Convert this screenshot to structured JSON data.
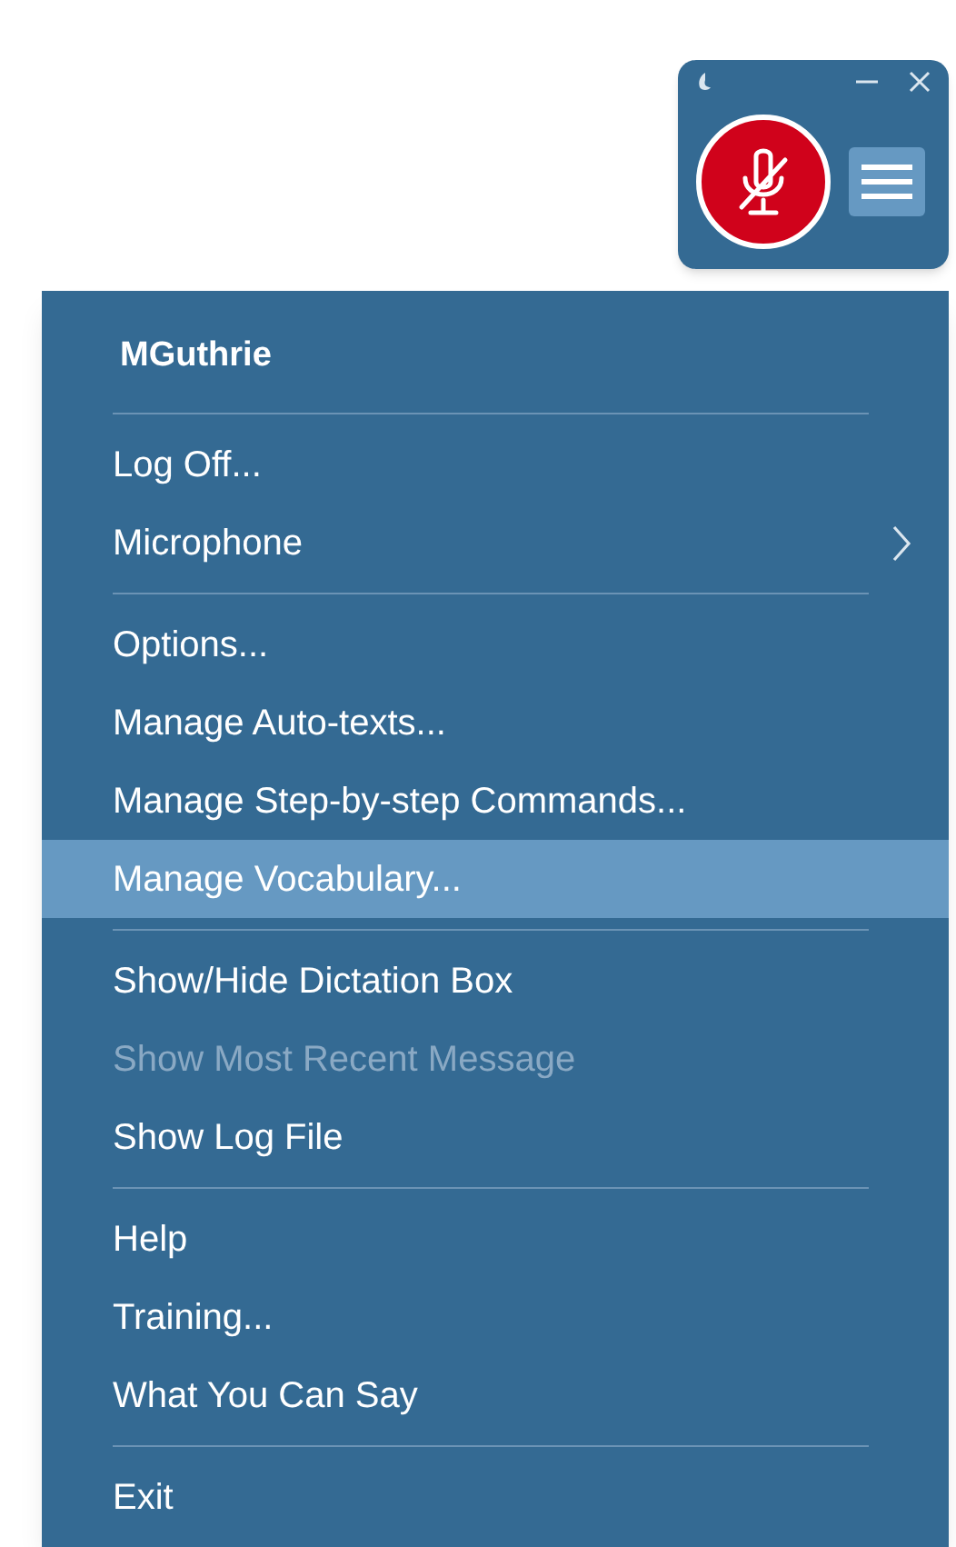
{
  "widget": {
    "menu_open": true
  },
  "menu": {
    "header": "MGuthrie",
    "groups": [
      [
        {
          "label": "Log Off...",
          "selected": false,
          "disabled": false,
          "has_submenu": false
        },
        {
          "label": "Microphone",
          "selected": false,
          "disabled": false,
          "has_submenu": true
        }
      ],
      [
        {
          "label": "Options...",
          "selected": false,
          "disabled": false,
          "has_submenu": false
        },
        {
          "label": "Manage Auto-texts...",
          "selected": false,
          "disabled": false,
          "has_submenu": false
        },
        {
          "label": "Manage Step-by-step Commands...",
          "selected": false,
          "disabled": false,
          "has_submenu": false
        },
        {
          "label": "Manage Vocabulary...",
          "selected": true,
          "disabled": false,
          "has_submenu": false
        }
      ],
      [
        {
          "label": "Show/Hide Dictation Box",
          "selected": false,
          "disabled": false,
          "has_submenu": false
        },
        {
          "label": "Show Most Recent Message",
          "selected": false,
          "disabled": true,
          "has_submenu": false
        },
        {
          "label": "Show Log File",
          "selected": false,
          "disabled": false,
          "has_submenu": false
        }
      ],
      [
        {
          "label": "Help",
          "selected": false,
          "disabled": false,
          "has_submenu": false
        },
        {
          "label": "Training...",
          "selected": false,
          "disabled": false,
          "has_submenu": false
        },
        {
          "label": "What You Can Say",
          "selected": false,
          "disabled": false,
          "has_submenu": false
        }
      ],
      [
        {
          "label": "Exit",
          "selected": false,
          "disabled": false,
          "has_submenu": false
        }
      ]
    ]
  }
}
